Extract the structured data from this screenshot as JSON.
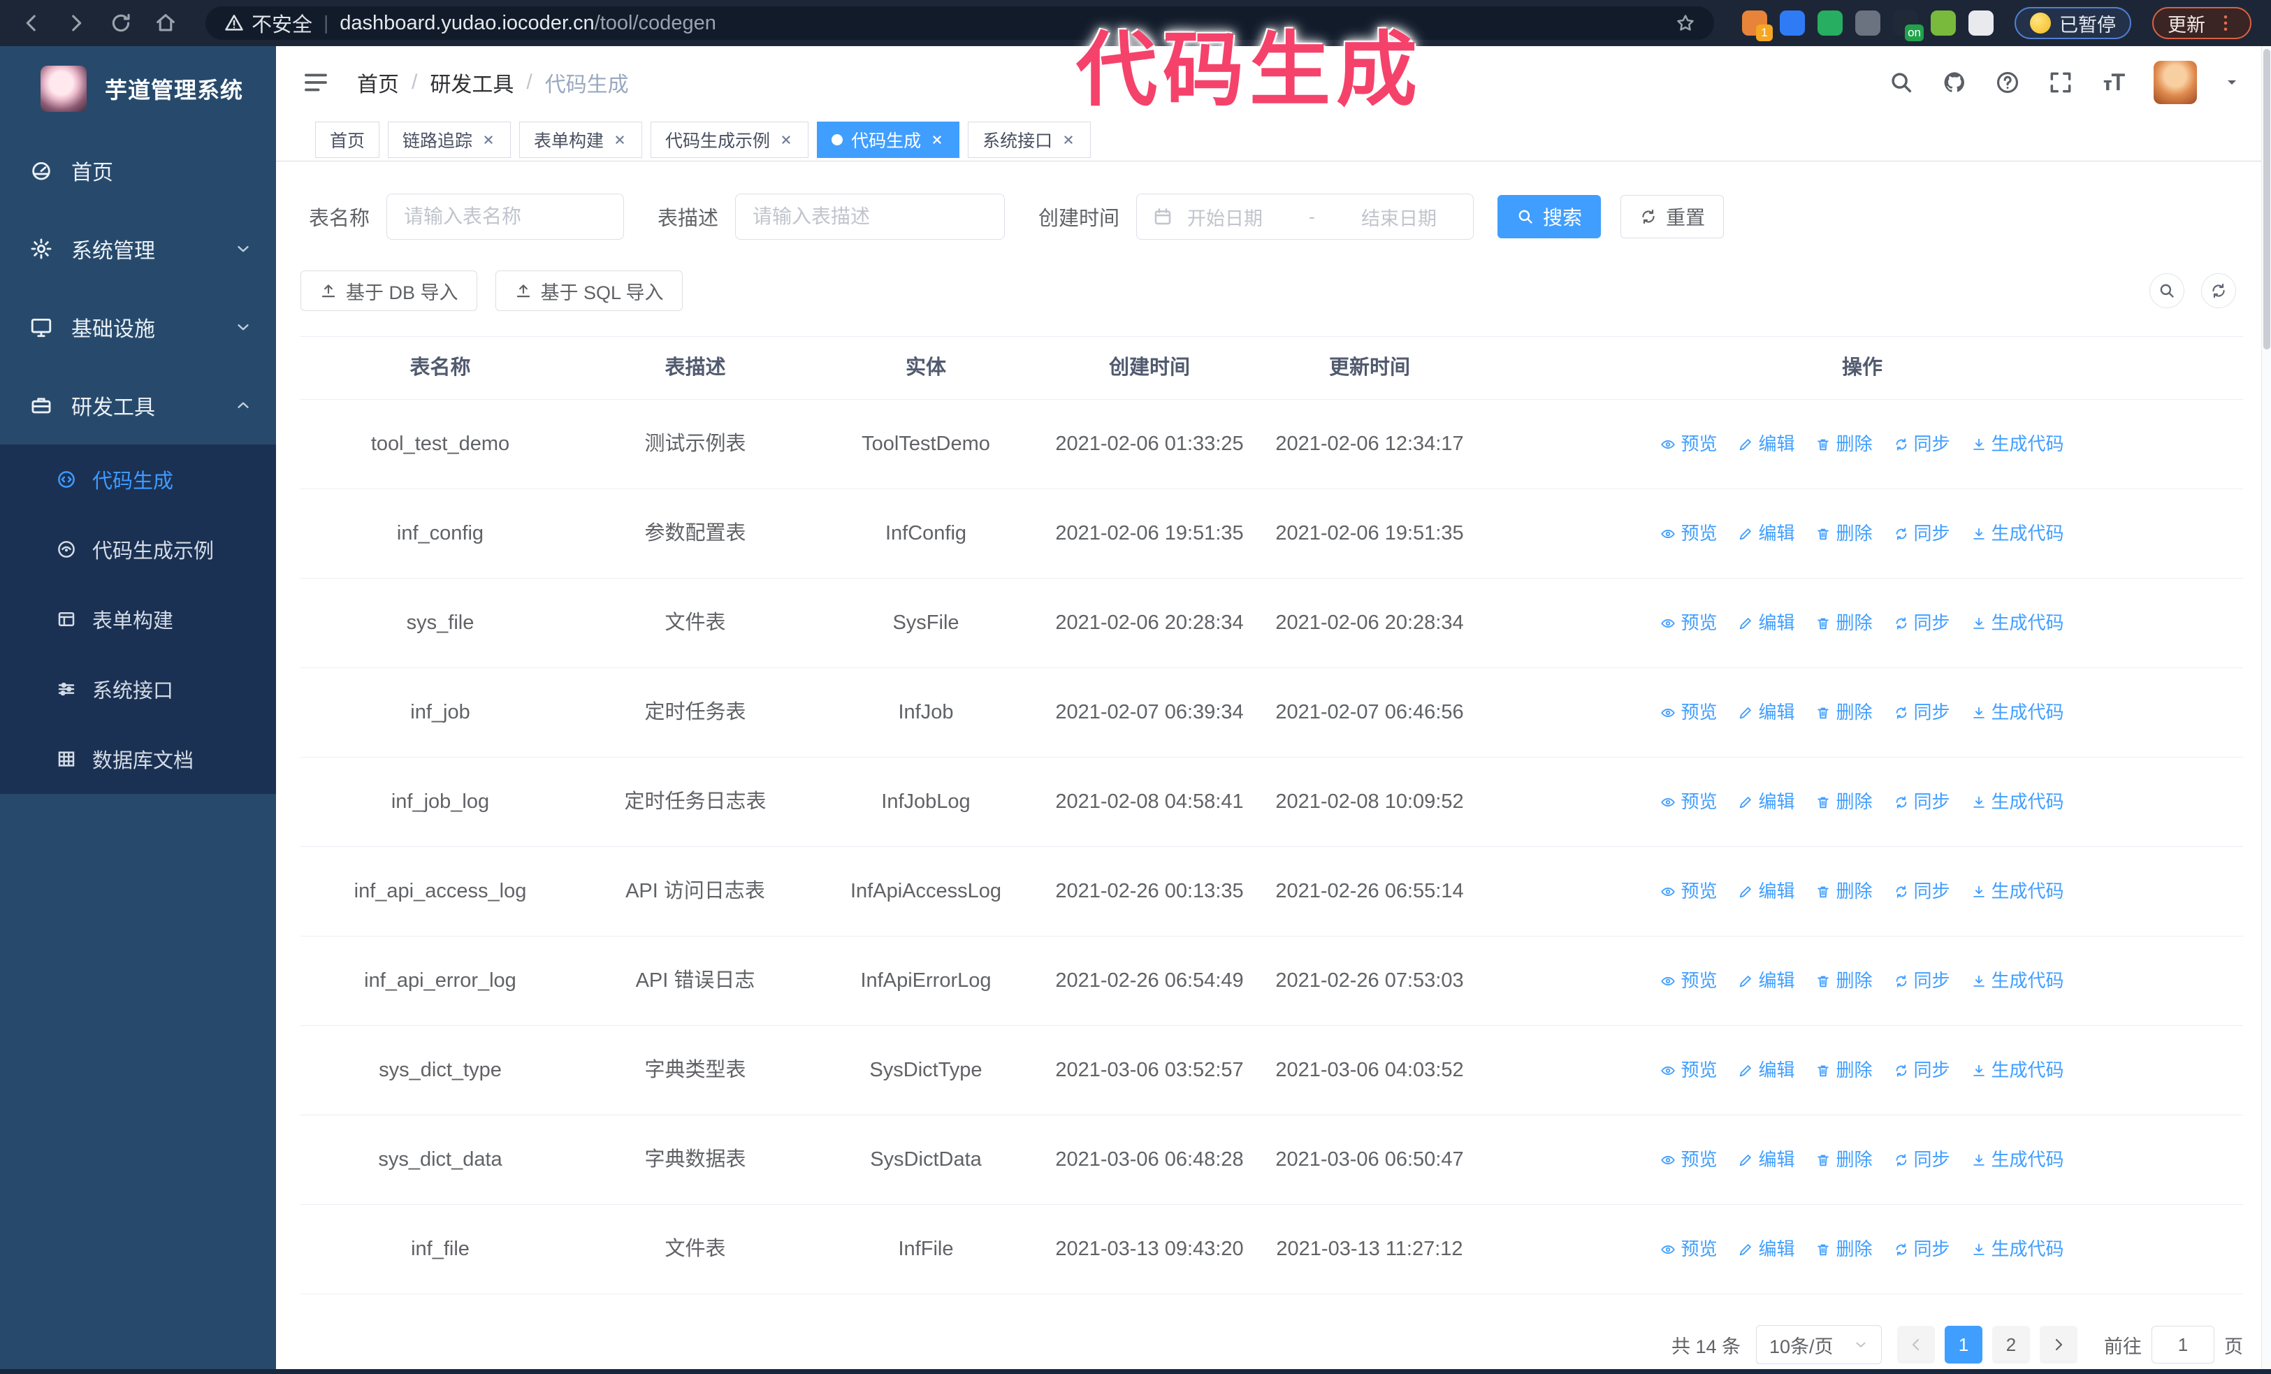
{
  "browser": {
    "security_warning": "不安全",
    "url_host": "dashboard.yudao.iocoder.cn",
    "url_path": "/tool/codegen",
    "divider": "|",
    "extensions": [
      {
        "bg": "#e8833a",
        "badge": "1",
        "badge_bg": "#f5a623"
      },
      {
        "bg": "#2f7bf6"
      },
      {
        "bg": "#27ae60"
      },
      {
        "bg": "#6b7280",
        "accent": "#3b82f6"
      },
      {
        "bg": "#1f2937",
        "badge": "on",
        "badge_bg": "#22a14b"
      },
      {
        "bg": "#79b93c"
      },
      {
        "bg": "#e8eaed"
      }
    ],
    "paused_badge": "已暂停",
    "update_button": "更新"
  },
  "annotation": {
    "text": "代码生成",
    "color": "#f5426b"
  },
  "sidebar": {
    "title": "芋道管理系统",
    "menu": [
      {
        "icon": "dashboard-icon",
        "label": "首页",
        "chevron": ""
      },
      {
        "icon": "gear-icon",
        "label": "系统管理",
        "chevron": "down"
      },
      {
        "icon": "monitor-icon",
        "label": "基础设施",
        "chevron": "down"
      },
      {
        "icon": "toolbox-icon",
        "label": "研发工具",
        "chevron": "up"
      }
    ],
    "submenu": [
      {
        "icon": "code-icon",
        "label": "代码生成",
        "state": "active"
      },
      {
        "icon": "example-icon",
        "label": "代码生成示例",
        "state": ""
      },
      {
        "icon": "form-icon",
        "label": "表单构建",
        "state": ""
      },
      {
        "icon": "sliders-icon",
        "label": "系统接口",
        "state": ""
      },
      {
        "icon": "grid-icon",
        "label": "数据库文档",
        "state": ""
      }
    ]
  },
  "header": {
    "breadcrumb": [
      "首页",
      "研发工具",
      "代码生成"
    ],
    "separator": "/"
  },
  "tabs": [
    {
      "label": "首页",
      "state": "",
      "closable": false
    },
    {
      "label": "链路追踪",
      "state": "",
      "closable": true
    },
    {
      "label": "表单构建",
      "state": "",
      "closable": true
    },
    {
      "label": "代码生成示例",
      "state": "",
      "closable": true
    },
    {
      "label": "代码生成",
      "state": "active",
      "closable": true
    },
    {
      "label": "系统接口",
      "state": "",
      "closable": true
    }
  ],
  "filters": {
    "name_label": "表名称",
    "name_placeholder": "请输入表名称",
    "desc_label": "表描述",
    "desc_placeholder": "请输入表描述",
    "time_label": "创建时间",
    "start_placeholder": "开始日期",
    "end_placeholder": "结束日期",
    "range_separator": "-",
    "search_button": "搜索",
    "reset_button": "重置"
  },
  "toolbar": {
    "import_db": "基于 DB 导入",
    "import_sql": "基于 SQL 导入"
  },
  "table": {
    "columns": [
      "表名称",
      "表描述",
      "实体",
      "创建时间",
      "更新时间",
      "操作"
    ],
    "actions": [
      {
        "icon": "eye-icon",
        "label": "预览"
      },
      {
        "icon": "pencil-icon",
        "label": "编辑"
      },
      {
        "icon": "trash-icon",
        "label": "删除"
      },
      {
        "icon": "sync-icon",
        "label": "同步"
      },
      {
        "icon": "download-icon",
        "label": "生成代码"
      }
    ],
    "rows": [
      {
        "name": "tool_test_demo",
        "desc": "测试示例表",
        "entity": "ToolTestDemo",
        "created": "2021-02-06 01:33:25",
        "updated": "2021-02-06 12:34:17"
      },
      {
        "name": "inf_config",
        "desc": "参数配置表",
        "entity": "InfConfig",
        "created": "2021-02-06 19:51:35",
        "updated": "2021-02-06 19:51:35"
      },
      {
        "name": "sys_file",
        "desc": "文件表",
        "entity": "SysFile",
        "created": "2021-02-06 20:28:34",
        "updated": "2021-02-06 20:28:34"
      },
      {
        "name": "inf_job",
        "desc": "定时任务表",
        "entity": "InfJob",
        "created": "2021-02-07 06:39:34",
        "updated": "2021-02-07 06:46:56"
      },
      {
        "name": "inf_job_log",
        "desc": "定时任务日志表",
        "entity": "InfJobLog",
        "created": "2021-02-08 04:58:41",
        "updated": "2021-02-08 10:09:52"
      },
      {
        "name": "inf_api_access_log",
        "desc": "API 访问日志表",
        "entity": "InfApiAccessLog",
        "created": "2021-02-26 00:13:35",
        "updated": "2021-02-26 06:55:14"
      },
      {
        "name": "inf_api_error_log",
        "desc": "API 错误日志",
        "entity": "InfApiErrorLog",
        "created": "2021-02-26 06:54:49",
        "updated": "2021-02-26 07:53:03"
      },
      {
        "name": "sys_dict_type",
        "desc": "字典类型表",
        "entity": "SysDictType",
        "created": "2021-03-06 03:52:57",
        "updated": "2021-03-06 04:03:52"
      },
      {
        "name": "sys_dict_data",
        "desc": "字典数据表",
        "entity": "SysDictData",
        "created": "2021-03-06 06:48:28",
        "updated": "2021-03-06 06:50:47"
      },
      {
        "name": "inf_file",
        "desc": "文件表",
        "entity": "InfFile",
        "created": "2021-03-13 09:43:20",
        "updated": "2021-03-13 11:27:12"
      }
    ]
  },
  "pagination": {
    "total": "共 14 条",
    "page_size": "10条/页",
    "pages": [
      {
        "num": "1",
        "state": "active"
      },
      {
        "num": "2",
        "state": ""
      }
    ],
    "goto_label": "前往",
    "goto_value": "1",
    "goto_suffix": "页"
  },
  "colors": {
    "accent": "#409eff",
    "sidebar": "#274a6c",
    "submenu": "#1b3153",
    "navbar": "#1d2637",
    "annotation": "#f5426b"
  }
}
